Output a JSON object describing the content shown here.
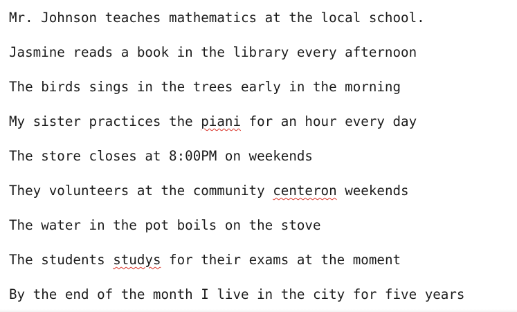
{
  "document": {
    "lines": [
      {
        "segments": [
          {
            "text": "Mr. Johnson teaches mathematics at the local school.",
            "misspelled": false
          }
        ]
      },
      {
        "segments": [
          {
            "text": "Jasmine reads a book in the library every afternoon",
            "misspelled": false
          }
        ]
      },
      {
        "segments": [
          {
            "text": "The birds sings in the trees early in the morning",
            "misspelled": false
          }
        ]
      },
      {
        "segments": [
          {
            "text": "My sister practices the ",
            "misspelled": false
          },
          {
            "text": "piani",
            "misspelled": true
          },
          {
            "text": " for an hour every day",
            "misspelled": false
          }
        ]
      },
      {
        "segments": [
          {
            "text": "The store closes at 8:00PM on weekends",
            "misspelled": false
          }
        ]
      },
      {
        "segments": [
          {
            "text": "They volunteers at the community ",
            "misspelled": false
          },
          {
            "text": "centeron",
            "misspelled": true
          },
          {
            "text": " weekends",
            "misspelled": false
          }
        ]
      },
      {
        "segments": [
          {
            "text": "The water in the pot boils on the stove",
            "misspelled": false
          }
        ]
      },
      {
        "segments": [
          {
            "text": "The students ",
            "misspelled": false
          },
          {
            "text": "studys",
            "misspelled": true
          },
          {
            "text": " for their exams at the moment",
            "misspelled": false
          }
        ]
      },
      {
        "segments": [
          {
            "text": "By the end of the month I live in the city for five years",
            "misspelled": false
          }
        ]
      }
    ]
  },
  "colors": {
    "text": "#1b1b1b",
    "spellcheck_underline": "#d93025",
    "background": "#ffffff"
  }
}
